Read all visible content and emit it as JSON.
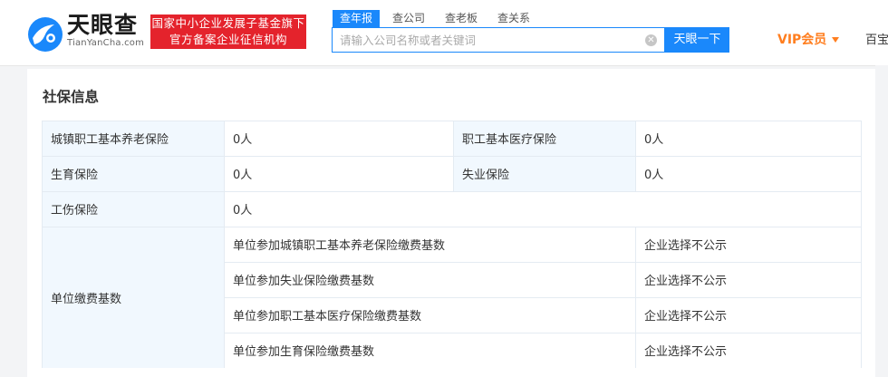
{
  "header": {
    "logo_text": "天眼查",
    "logo_subtext": "TianYanCha.com",
    "badge_line1": "国家中小企业发展子基金旗下",
    "badge_line2": "官方备案企业征信机构",
    "tabs": [
      {
        "label": "查年报",
        "active": true
      },
      {
        "label": "查公司",
        "active": false
      },
      {
        "label": "查老板",
        "active": false
      },
      {
        "label": "查关系",
        "active": false
      }
    ],
    "search_placeholder": "请输入公司名称或者关键词",
    "search_value": "",
    "search_button": "天眼一下",
    "vip_label": "VIP会员",
    "nav_cut_label": "百宝",
    "accent_color": "#1a88fb",
    "badge_color": "#e4232c",
    "vip_color": "#ff7e1f"
  },
  "section": {
    "title": "社保信息",
    "rows": [
      {
        "label1": "城镇职工基本养老保险",
        "value1": "0人",
        "label2": "职工基本医疗保险",
        "value2": "0人"
      },
      {
        "label1": "生育保险",
        "value1": "0人",
        "label2": "失业保险",
        "value2": "0人"
      },
      {
        "label1": "工伤保险",
        "value1": "0人"
      }
    ],
    "base_label": "单位缴费基数",
    "base_items": [
      {
        "name": "单位参加城镇职工基本养老保险缴费基数",
        "value": "企业选择不公示"
      },
      {
        "name": "单位参加失业保险缴费基数",
        "value": "企业选择不公示"
      },
      {
        "name": "单位参加职工基本医疗保险缴费基数",
        "value": "企业选择不公示"
      },
      {
        "name": "单位参加生育保险缴费基数",
        "value": "企业选择不公示"
      }
    ]
  }
}
